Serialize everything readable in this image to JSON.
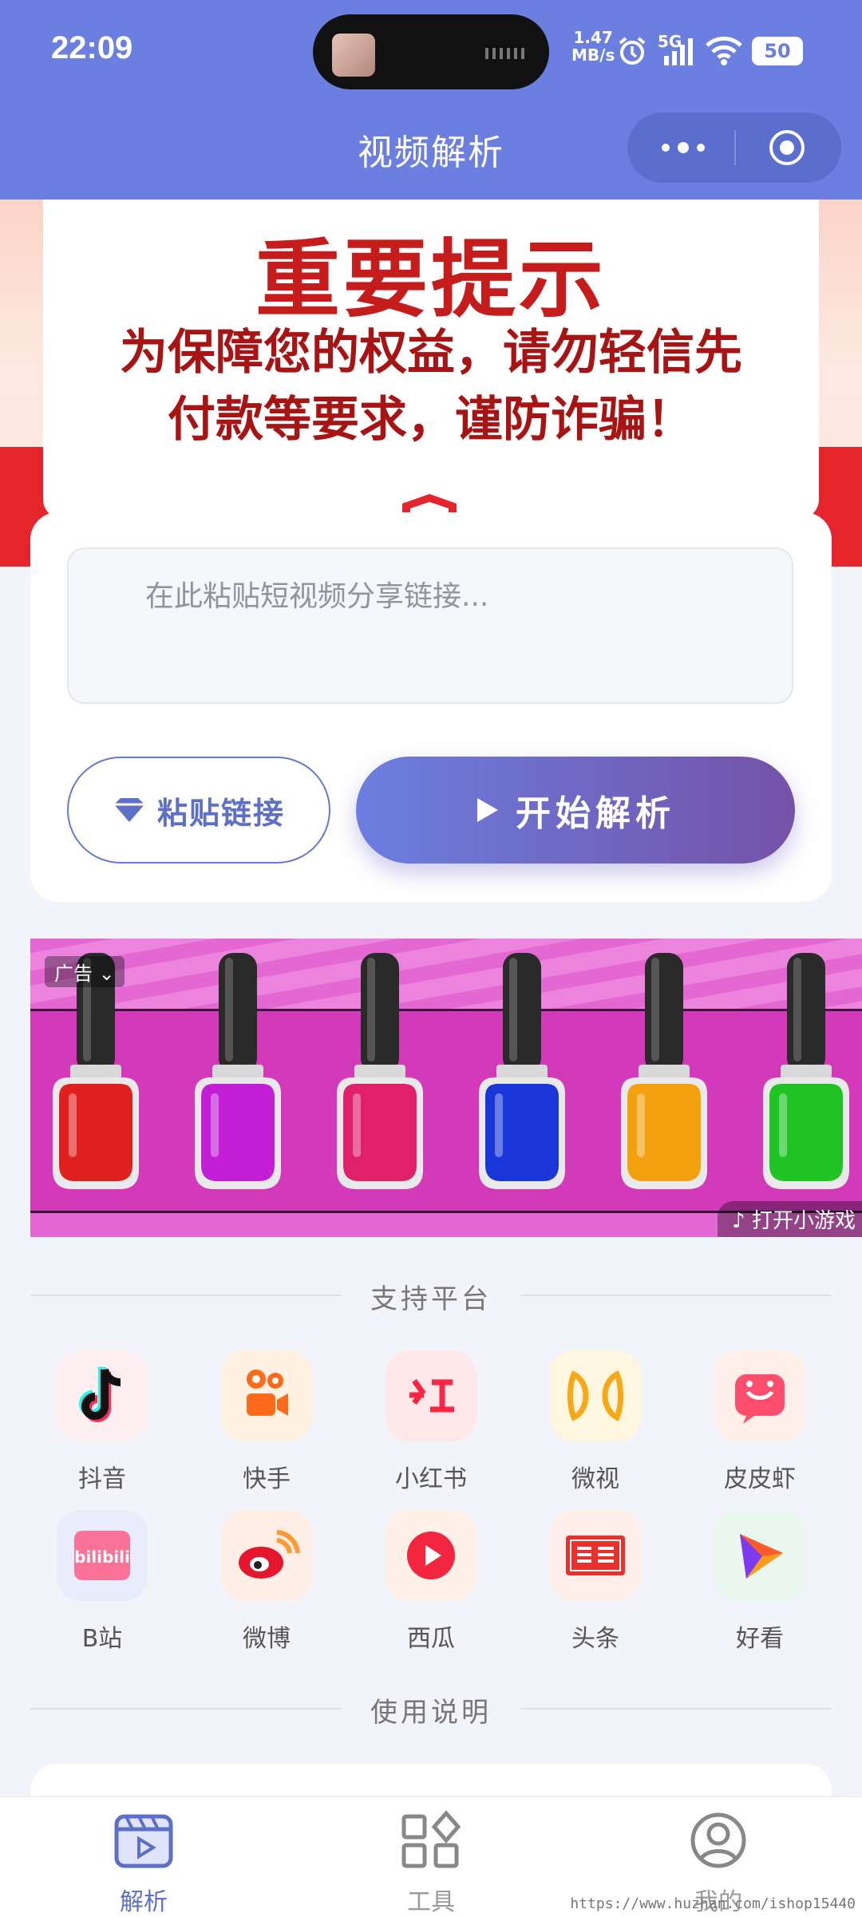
{
  "status_bar": {
    "time": "22:09",
    "net_speed_value": "1.47",
    "net_speed_unit": "MB/s",
    "network": "5G",
    "battery": "50"
  },
  "nav": {
    "title": "视频解析"
  },
  "notice": {
    "title": "重要提示",
    "line1": "为保障您的权益，请勿轻信先",
    "line2": "付款等要求，谨防诈骗！"
  },
  "parse": {
    "placeholder": "在此粘贴短视频分享链接...",
    "paste_label": "粘贴链接",
    "start_label": "开始解析"
  },
  "ad": {
    "tag": "广告",
    "open_label": "打开小游戏",
    "bottle_colors": [
      "#e01f1f",
      "#c21fd6",
      "#e0206a",
      "#1b36d8",
      "#f3a00f",
      "#1fc324"
    ]
  },
  "platforms_section": {
    "label": "支持平台",
    "items": [
      {
        "name": "抖音",
        "icon": "douyin-icon"
      },
      {
        "name": "快手",
        "icon": "kuaishou-icon"
      },
      {
        "name": "小红书",
        "icon": "xiaohongshu-icon"
      },
      {
        "name": "微视",
        "icon": "weishi-icon"
      },
      {
        "name": "皮皮虾",
        "icon": "pipixia-icon"
      },
      {
        "name": "B站",
        "icon": "bilibili-icon"
      },
      {
        "name": "微博",
        "icon": "weibo-icon"
      },
      {
        "name": "西瓜",
        "icon": "xigua-icon"
      },
      {
        "name": "头条",
        "icon": "toutiao-icon"
      },
      {
        "name": "好看",
        "icon": "haokan-icon"
      }
    ]
  },
  "usage_section": {
    "label": "使用说明"
  },
  "tabbar": {
    "tabs": [
      {
        "label": "解析",
        "icon": "video-parse-icon",
        "active": true
      },
      {
        "label": "工具",
        "icon": "tools-grid-icon",
        "active": false
      },
      {
        "label": "我的",
        "icon": "user-profile-icon",
        "active": false
      }
    ]
  },
  "colors": {
    "brand": "#6a7fe0",
    "accent_gradient_end": "#7452a8",
    "warning_red": "#c61c1c"
  },
  "watermark": "https://www.huzhan.com/ishop15440"
}
